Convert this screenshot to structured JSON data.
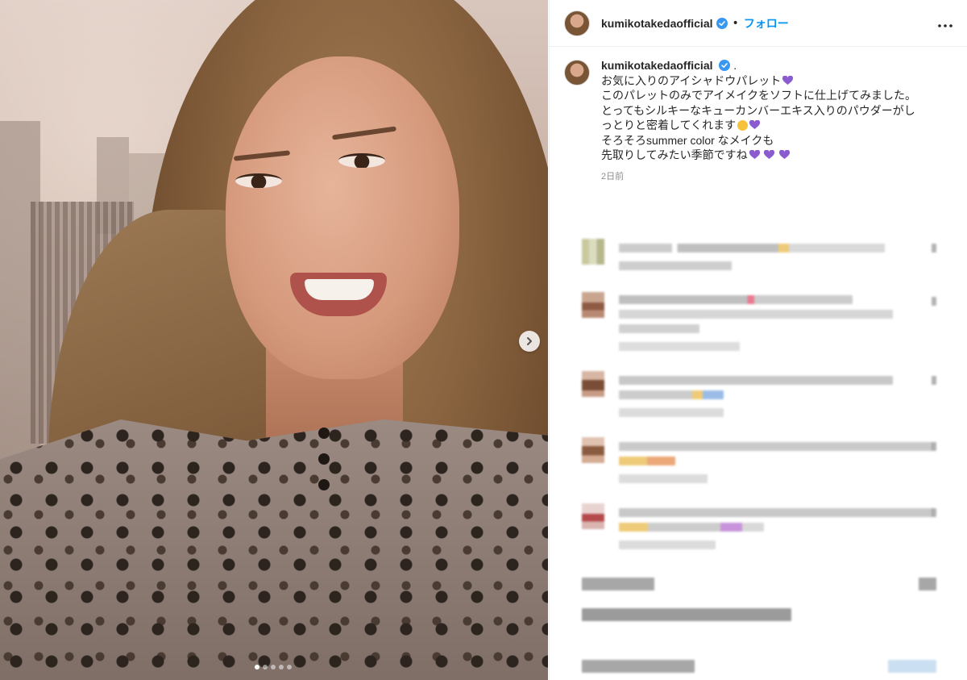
{
  "post": {
    "image_alt": "",
    "carousel": {
      "total": 5,
      "active": 0
    }
  },
  "header": {
    "username": "kumikotakedaofficial",
    "separator": "•",
    "follow_label": "フォロー",
    "more_label": "•••"
  },
  "caption": {
    "username": "kumikotakedaofficial",
    "lead": ".",
    "lines": [
      "お気に入りのアイシャドウパレット",
      "このパレットのみでアイメイクをソフトに仕上げてみました。",
      "とってもシルキーなキューカンバーエキス入りのパウダーがし",
      "っとりと密着してくれます",
      "そろそろsummer color なメイクも",
      "先取りしてみたい季節ですね"
    ],
    "timestamp": "2日前"
  },
  "colors": {
    "accent": "#0095f6",
    "verified": "#3897f0",
    "heart": "#8a5cd0",
    "muted": "#8e8e8e"
  },
  "icons": {
    "verified": "verified-badge-icon",
    "next": "chevron-right-icon",
    "heart": "purple-heart-emoji",
    "smile": "smiling-face-emoji"
  }
}
